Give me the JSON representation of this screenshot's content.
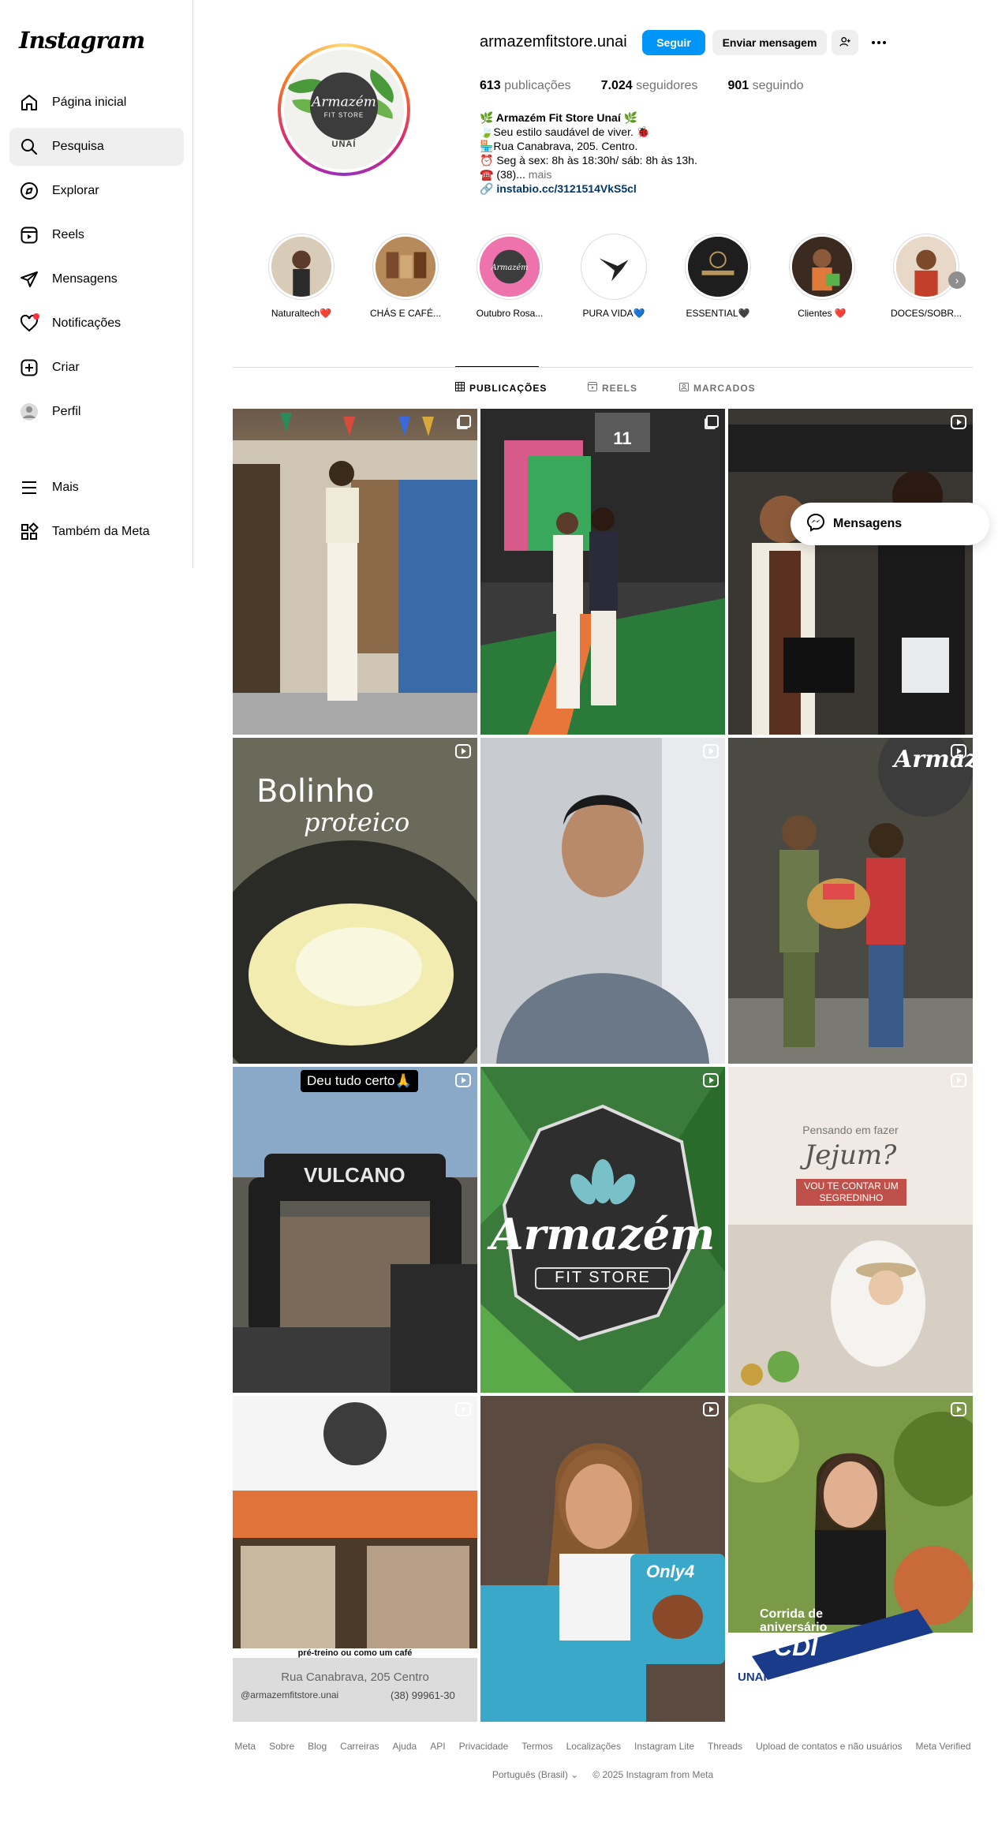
{
  "app": {
    "logo": "Instagram"
  },
  "sidebar": {
    "items": [
      {
        "label": "Página inicial",
        "icon": "home-icon"
      },
      {
        "label": "Pesquisa",
        "icon": "search-icon"
      },
      {
        "label": "Explorar",
        "icon": "compass-icon"
      },
      {
        "label": "Reels",
        "icon": "reels-icon"
      },
      {
        "label": "Mensagens",
        "icon": "paper-plane-icon"
      },
      {
        "label": "Notificações",
        "icon": "heart-icon"
      },
      {
        "label": "Criar",
        "icon": "plus-square-icon"
      },
      {
        "label": "Perfil",
        "icon": "profile-avatar-icon"
      },
      {
        "label": "Mais",
        "icon": "menu-icon"
      },
      {
        "label": "Também da Meta",
        "icon": "meta-apps-icon"
      }
    ]
  },
  "profile": {
    "avatar_text": "Armazém",
    "avatar_subtext": "FIT STORE",
    "avatar_city": "UNAÍ",
    "username": "armazemfitstore.unai",
    "follow_label": "Seguir",
    "message_label": "Enviar mensagem",
    "stats": {
      "posts_count": "613",
      "posts_label": "publicações",
      "followers_count": "7.024",
      "followers_label": "seguidores",
      "following_count": "901",
      "following_label": "seguindo"
    },
    "bio": {
      "name": "🌿 Armazém Fit Store Unaí 🌿",
      "line1": "🍃Seu estilo saudável de viver. 🐞",
      "line2": "🏪Rua Canabrava, 205. Centro.",
      "line3": "⏰ Seg à sex: 8h às 18:30h/ sáb: 8h às 13h.",
      "line4": "☎️ (38)...",
      "more": "mais",
      "link": "instabio.cc/3121514VkS5cl"
    }
  },
  "highlights": [
    {
      "label": "Naturaltech❤️",
      "color": "#c9b8a3"
    },
    {
      "label": "CHÁS E CAFÉ...",
      "color": "#8a5a3a"
    },
    {
      "label": "Outubro Rosa...",
      "color": "#e86aa6"
    },
    {
      "label": "PURA VIDA💙",
      "color": "#ffffff"
    },
    {
      "label": "ESSENTIAL🖤",
      "color": "#1e1e1e"
    },
    {
      "label": "Clientes ❤️",
      "color": "#6a4a3a"
    },
    {
      "label": "DOCES/SOBR...",
      "color": "#c27a4a"
    }
  ],
  "tabs": [
    {
      "label": "PUBLICAÇÕES",
      "icon": "grid-icon"
    },
    {
      "label": "REELS",
      "icon": "reels-icon"
    },
    {
      "label": "MARCADOS",
      "icon": "tagged-icon"
    }
  ],
  "posts": [
    {
      "type": "carousel",
      "overlay": ""
    },
    {
      "type": "carousel",
      "overlay": "11"
    },
    {
      "type": "reel",
      "overlay": ""
    },
    {
      "type": "reel",
      "overlay": "Bolinho",
      "overlay2": "proteico"
    },
    {
      "type": "reel",
      "overlay": ""
    },
    {
      "type": "reel",
      "overlay": "Armazém"
    },
    {
      "type": "reel",
      "overlay": "Deu tudo certo🙏",
      "overlay2": "VULCANO"
    },
    {
      "type": "reel",
      "overlay": "Armazém",
      "overlay2": "FIT STORE"
    },
    {
      "type": "reel",
      "overlay": "Pensando em fazer",
      "overlay2": "Jejum?",
      "overlay3": "VOU TE CONTAR UM SEGREDINHO"
    },
    {
      "type": "reel",
      "overlay": "pré-treino ou como um café",
      "overlay2": "Rua Canabrava, 205 Centro",
      "overlay3": "@armazemfitstore.unai",
      "overlay4": "(38) 99961-30"
    },
    {
      "type": "reel",
      "overlay": "Only4"
    },
    {
      "type": "reel",
      "overlay": "Corrida de aniversário",
      "overlay2": "CDI",
      "overlay3": "UNAÍ"
    }
  ],
  "floating_messages": {
    "label": "Mensagens"
  },
  "footer": {
    "links": [
      "Meta",
      "Sobre",
      "Blog",
      "Carreiras",
      "Ajuda",
      "API",
      "Privacidade",
      "Termos",
      "Localizações",
      "Instagram Lite",
      "Threads",
      "Upload de contatos e não usuários",
      "Meta Verified"
    ],
    "language": "Português (Brasil)",
    "copyright": "© 2025 Instagram from Meta"
  }
}
